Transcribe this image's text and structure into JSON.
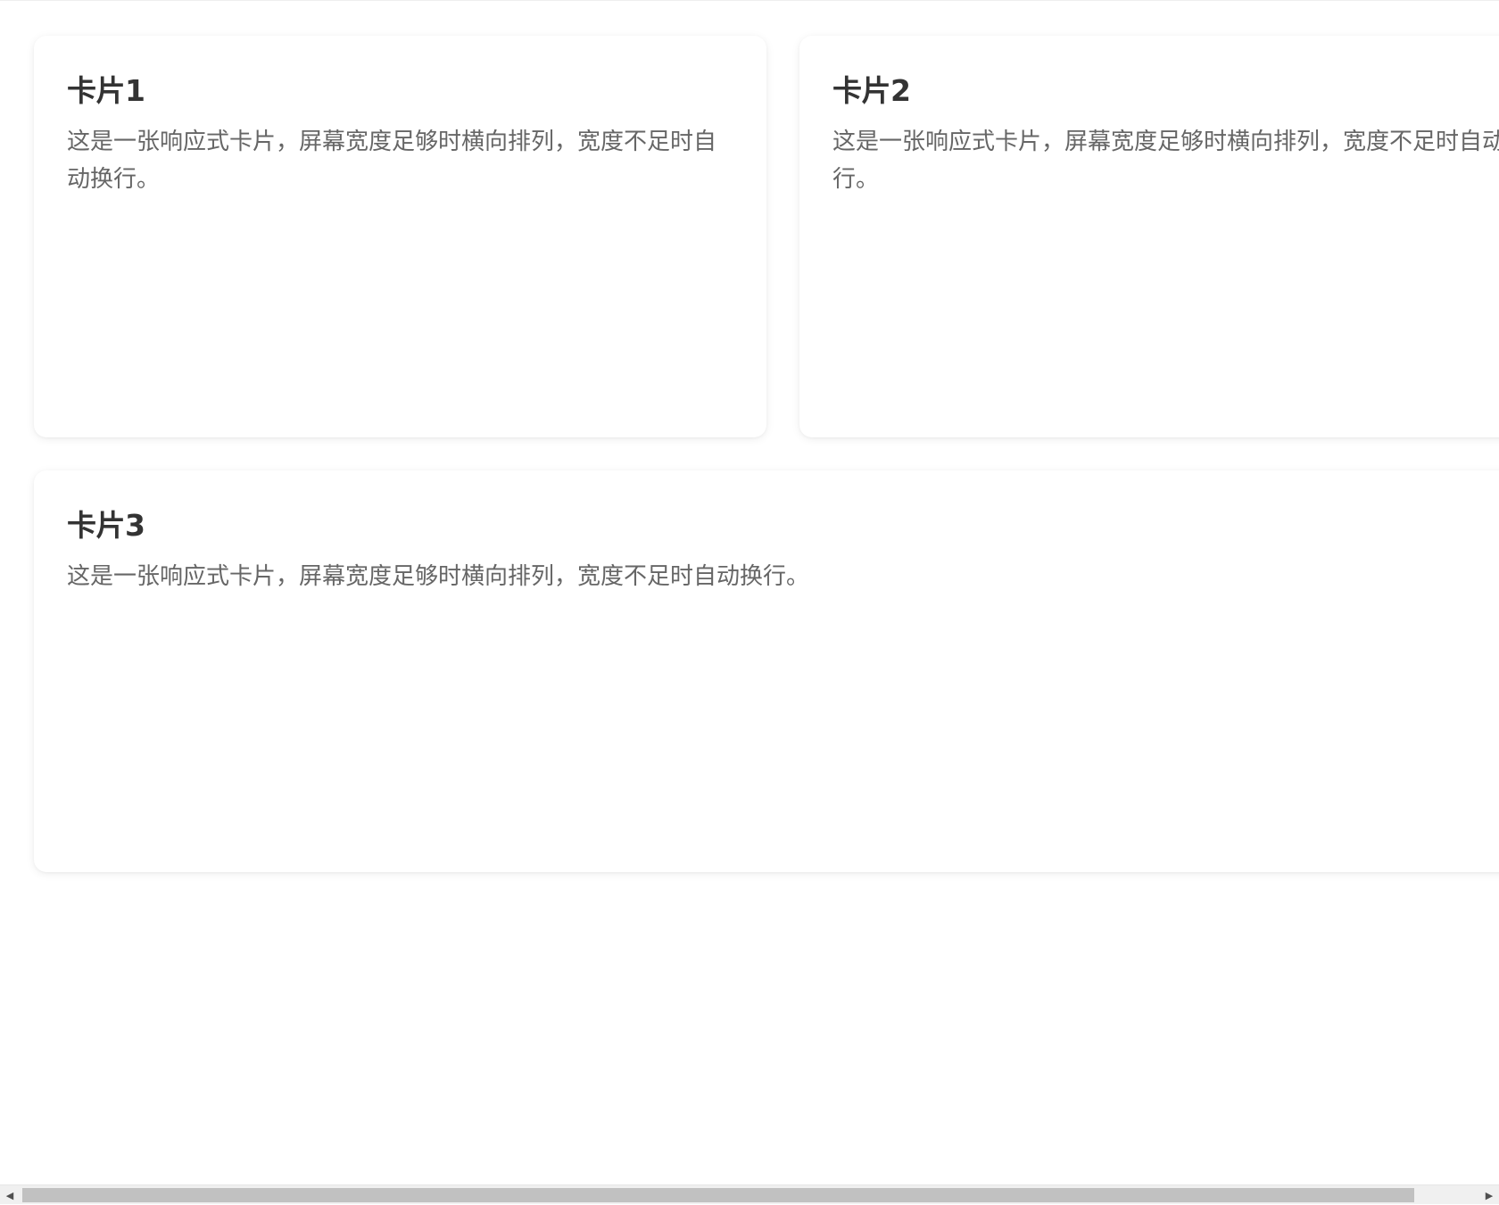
{
  "cards": [
    {
      "title": "卡片1",
      "text": "这是一张响应式卡片，屏幕宽度足够时横向排列，宽度不足时自动换行。"
    },
    {
      "title": "卡片2",
      "text": "这是一张响应式卡片，屏幕宽度足够时横向排列，宽度不足时自动换行。"
    },
    {
      "title": "卡片3",
      "text": "这是一张响应式卡片，屏幕宽度足够时横向排列，宽度不足时自动换行。"
    }
  ],
  "scrollbar": {
    "left_arrow_icon": "triangle-left-icon",
    "right_arrow_icon": "triangle-right-icon"
  }
}
